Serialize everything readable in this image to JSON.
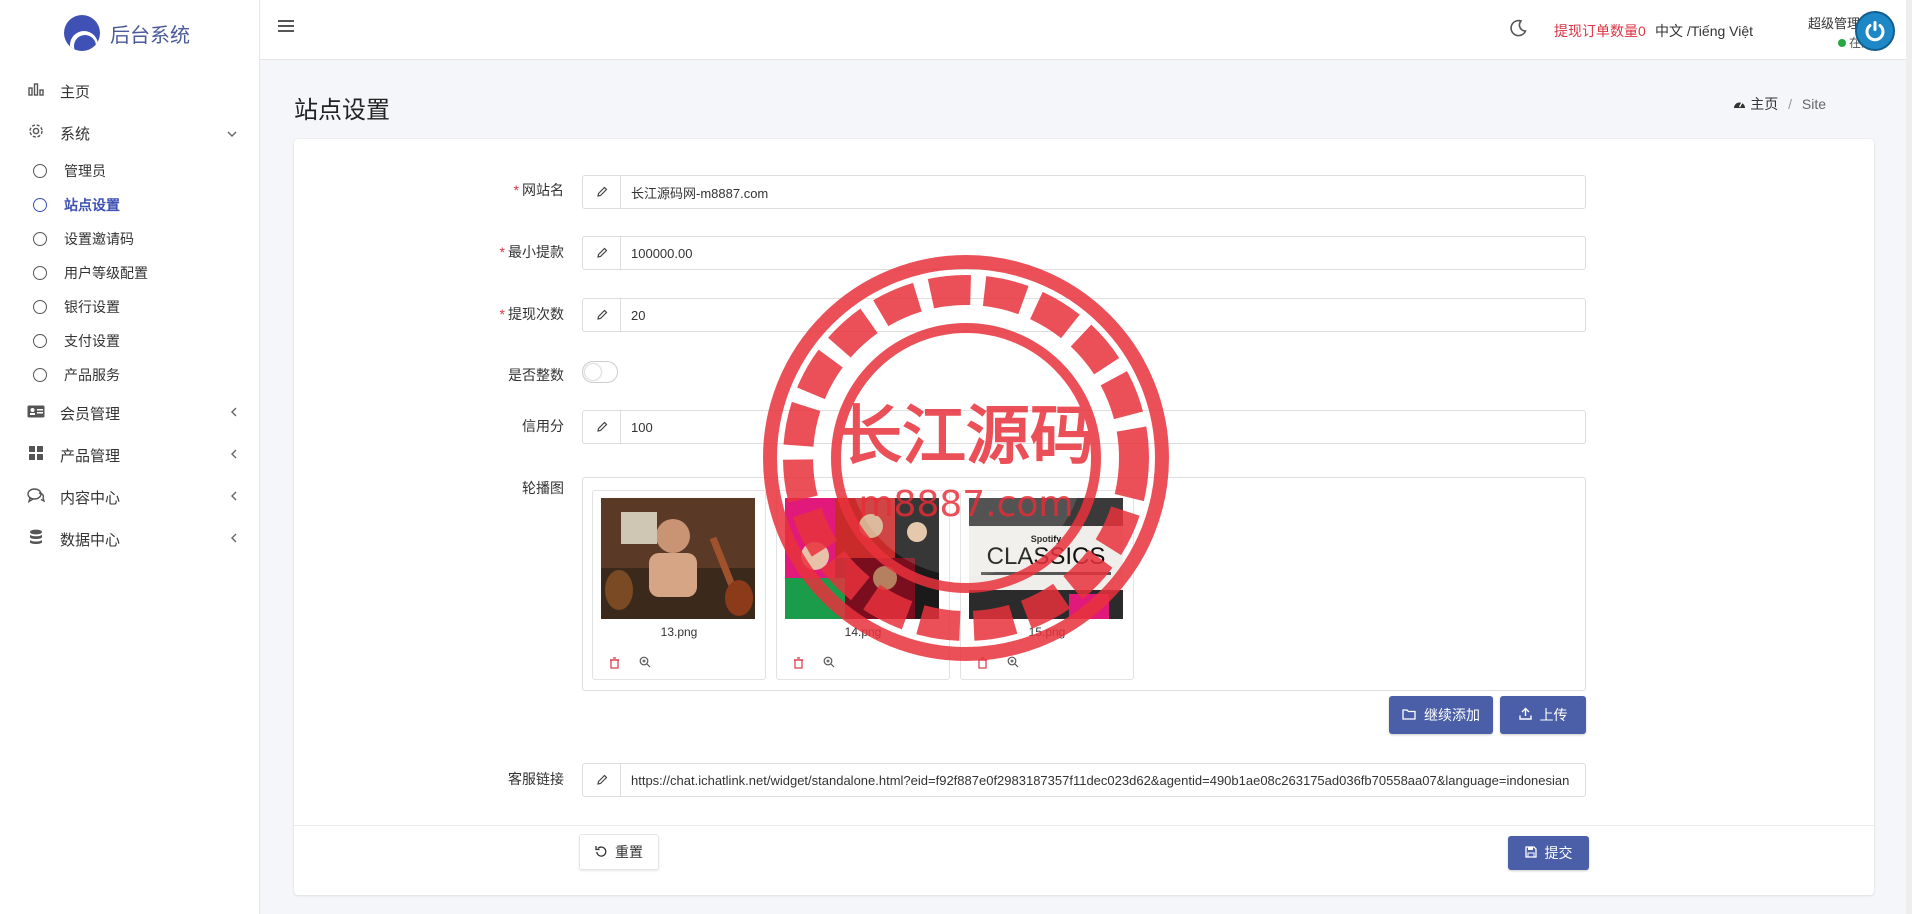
{
  "brand": {
    "title": "后台系统"
  },
  "sidebar": {
    "items": [
      {
        "label": "主页",
        "icon": "bar-chart-icon"
      },
      {
        "label": "系统",
        "icon": "gear-icon",
        "expanded": true,
        "children": [
          {
            "label": "管理员"
          },
          {
            "label": "站点设置",
            "active": true
          },
          {
            "label": "设置邀请码"
          },
          {
            "label": "用户等级配置"
          },
          {
            "label": "银行设置"
          },
          {
            "label": "支付设置"
          },
          {
            "label": "产品服务"
          }
        ]
      },
      {
        "label": "会员管理",
        "icon": "id-card-icon"
      },
      {
        "label": "产品管理",
        "icon": "grid-icon"
      },
      {
        "label": "内容中心",
        "icon": "chat-icon"
      },
      {
        "label": "数据中心",
        "icon": "database-icon"
      }
    ]
  },
  "topbar": {
    "withdraw_orders": "提现订单数量0",
    "language": "中文 /Tiếng Việt",
    "user_role": "超级管理员",
    "user_status": "在线"
  },
  "page": {
    "title": "站点设置",
    "breadcrumb_home": "主页",
    "breadcrumb_current": "Site"
  },
  "form": {
    "site_name_label": "网站名",
    "site_name_value": "长江源码网-m8887.com",
    "min_withdraw_label": "最小提款",
    "min_withdraw_value": "100000.00",
    "withdraw_times_label": "提现次数",
    "withdraw_times_value": "20",
    "integer_label": "是否整数",
    "integer_on": false,
    "credit_label": "信用分",
    "credit_value": "100",
    "carousel_label": "轮播图",
    "carousel_files": [
      "13.png",
      "14.png",
      "15.png"
    ],
    "continue_add_label": "继续添加",
    "upload_label": "上传",
    "support_link_label": "客服链接",
    "support_link_value": "https://chat.ichatlink.net/widget/standalone.html?eid=f92f887e0f2983187357f11dec023d62&agentid=490b1ae08c263175ad036fb70558aa07&language=indonesian",
    "reset_label": "重置",
    "submit_label": "提交"
  },
  "thumb_texts": {
    "spotify": "Spotify",
    "classics": "CLASSICS"
  },
  "watermark": {
    "text": "长江源码",
    "sub": "m8887.com"
  },
  "colors": {
    "accent": "#4a5fa8",
    "danger": "#dc3545",
    "online": "#28a745",
    "stamp": "#e8323c"
  }
}
